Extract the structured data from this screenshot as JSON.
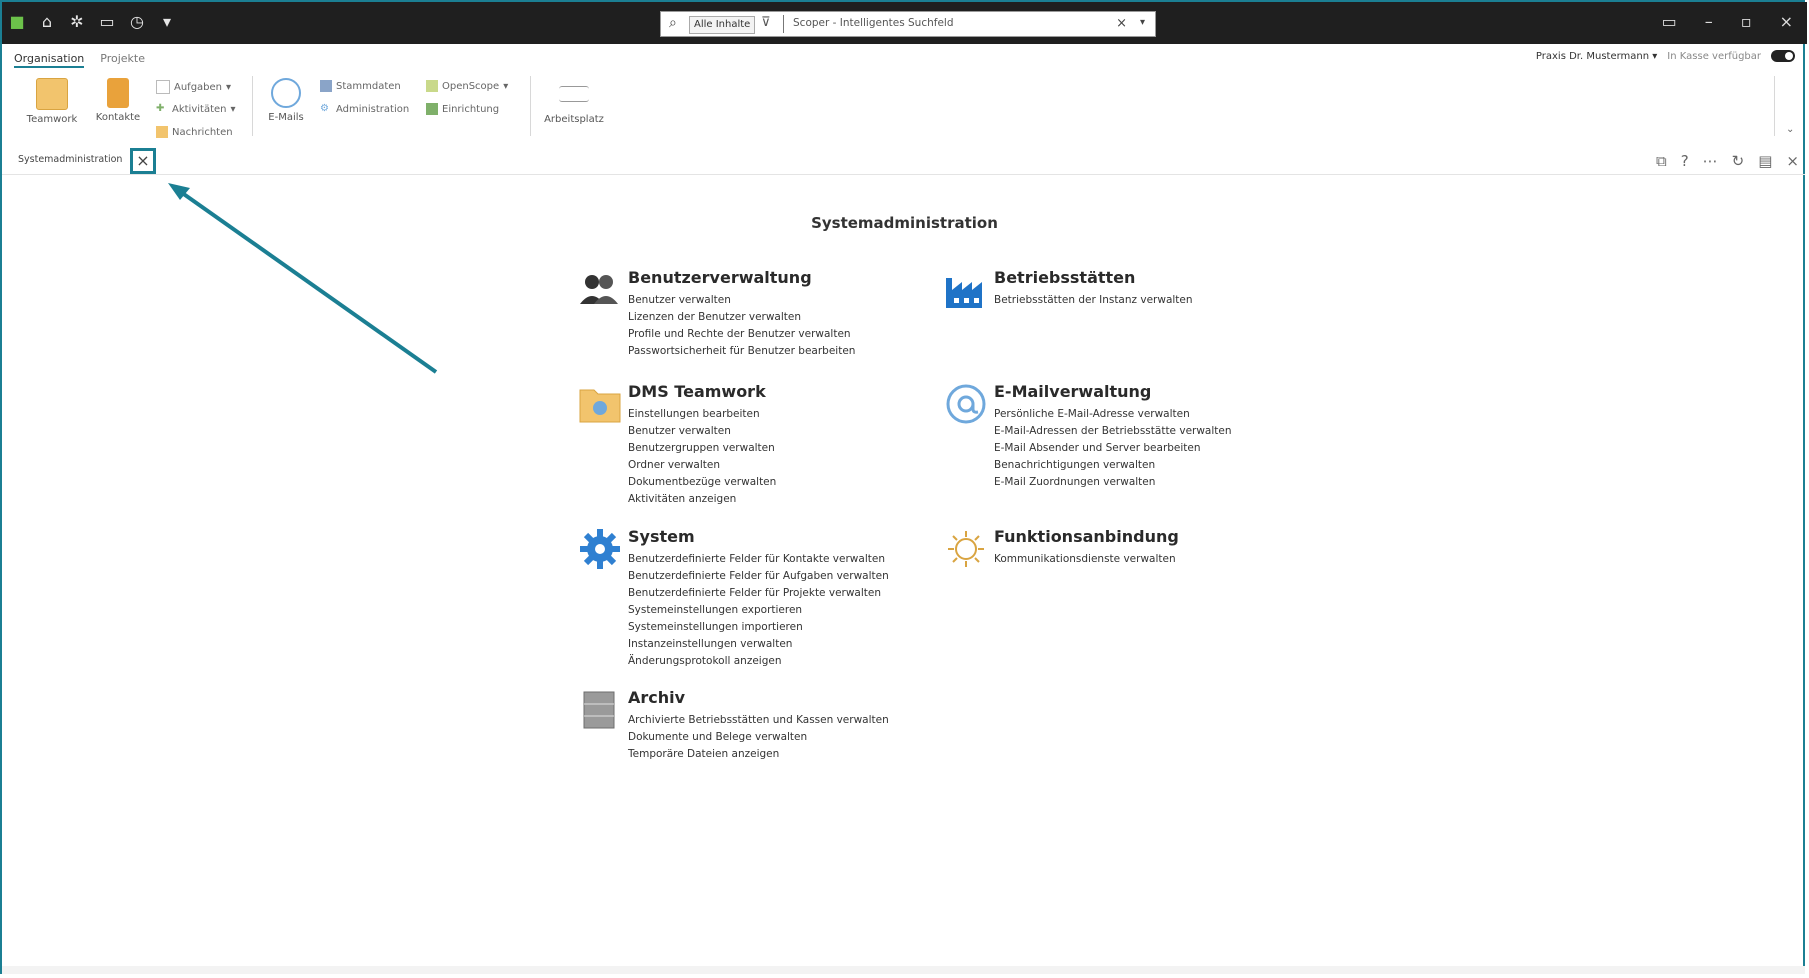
{
  "window": {
    "search": {
      "scope": "Alle Inhalte",
      "placeholder": "Scoper - Intelligentes Suchfeld"
    }
  },
  "ribbon": {
    "tabs": [
      "Organisation",
      "Projekte"
    ],
    "user": "Praxis Dr. Mustermann",
    "status": "In Kasse verfügbar",
    "buttons": {
      "teamwork": "Teamwork",
      "kontakte": "Kontakte",
      "aufgaben": "Aufgaben",
      "aktivitaeten": "Aktivitäten",
      "nachrichten": "Nachrichten",
      "email": "E-Mails",
      "stammdaten": "Stammdaten",
      "administration": "Administration",
      "openscope": "OpenScope",
      "einrichtung": "Einrichtung",
      "arbeitsplatz": "Arbeitsplatz"
    }
  },
  "doctab": {
    "label": "Systemadministration",
    "close": "×"
  },
  "content": {
    "title": "Systemadministration",
    "sections": [
      {
        "title": "Benutzerverwaltung",
        "links": [
          "Benutzer verwalten",
          "Lizenzen der Benutzer verwalten",
          "Profile und Rechte der Benutzer verwalten",
          "Passwortsicherheit für Benutzer bearbeiten"
        ]
      },
      {
        "title": "Betriebsstätten",
        "links": [
          "Betriebsstätten der Instanz verwalten"
        ]
      },
      {
        "title": "DMS Teamwork",
        "links": [
          "Einstellungen bearbeiten",
          "Benutzer verwalten",
          "Benutzergruppen verwalten",
          "Ordner verwalten",
          "Dokumentbezüge verwalten",
          "Aktivitäten anzeigen"
        ]
      },
      {
        "title": "E-Mailverwaltung",
        "links": [
          "Persönliche E-Mail-Adresse verwalten",
          "E-Mail-Adressen der Betriebsstätte verwalten",
          "E-Mail Absender und Server bearbeiten",
          "Benachrichtigungen verwalten",
          "E-Mail Zuordnungen verwalten"
        ]
      },
      {
        "title": "System",
        "links": [
          "Benutzerdefinierte Felder für Kontakte verwalten",
          "Benutzerdefinierte Felder für Aufgaben verwalten",
          "Benutzerdefinierte Felder für Projekte verwalten",
          "Systemeinstellungen exportieren",
          "Systemeinstellungen importieren",
          "Instanzeinstellungen verwalten",
          "Änderungsprotokoll anzeigen"
        ]
      },
      {
        "title": "Funktionsanbindung",
        "links": [
          "Kommunikationsdienste verwalten"
        ]
      },
      {
        "title": "Archiv",
        "links": [
          "Archivierte Betriebsstätten und Kassen verwalten",
          "Dokumente und Belege verwalten",
          "Temporäre Dateien anzeigen"
        ]
      }
    ]
  },
  "colors": {
    "accent": "#1b7f93",
    "titlebar": "#1f1f1f"
  }
}
